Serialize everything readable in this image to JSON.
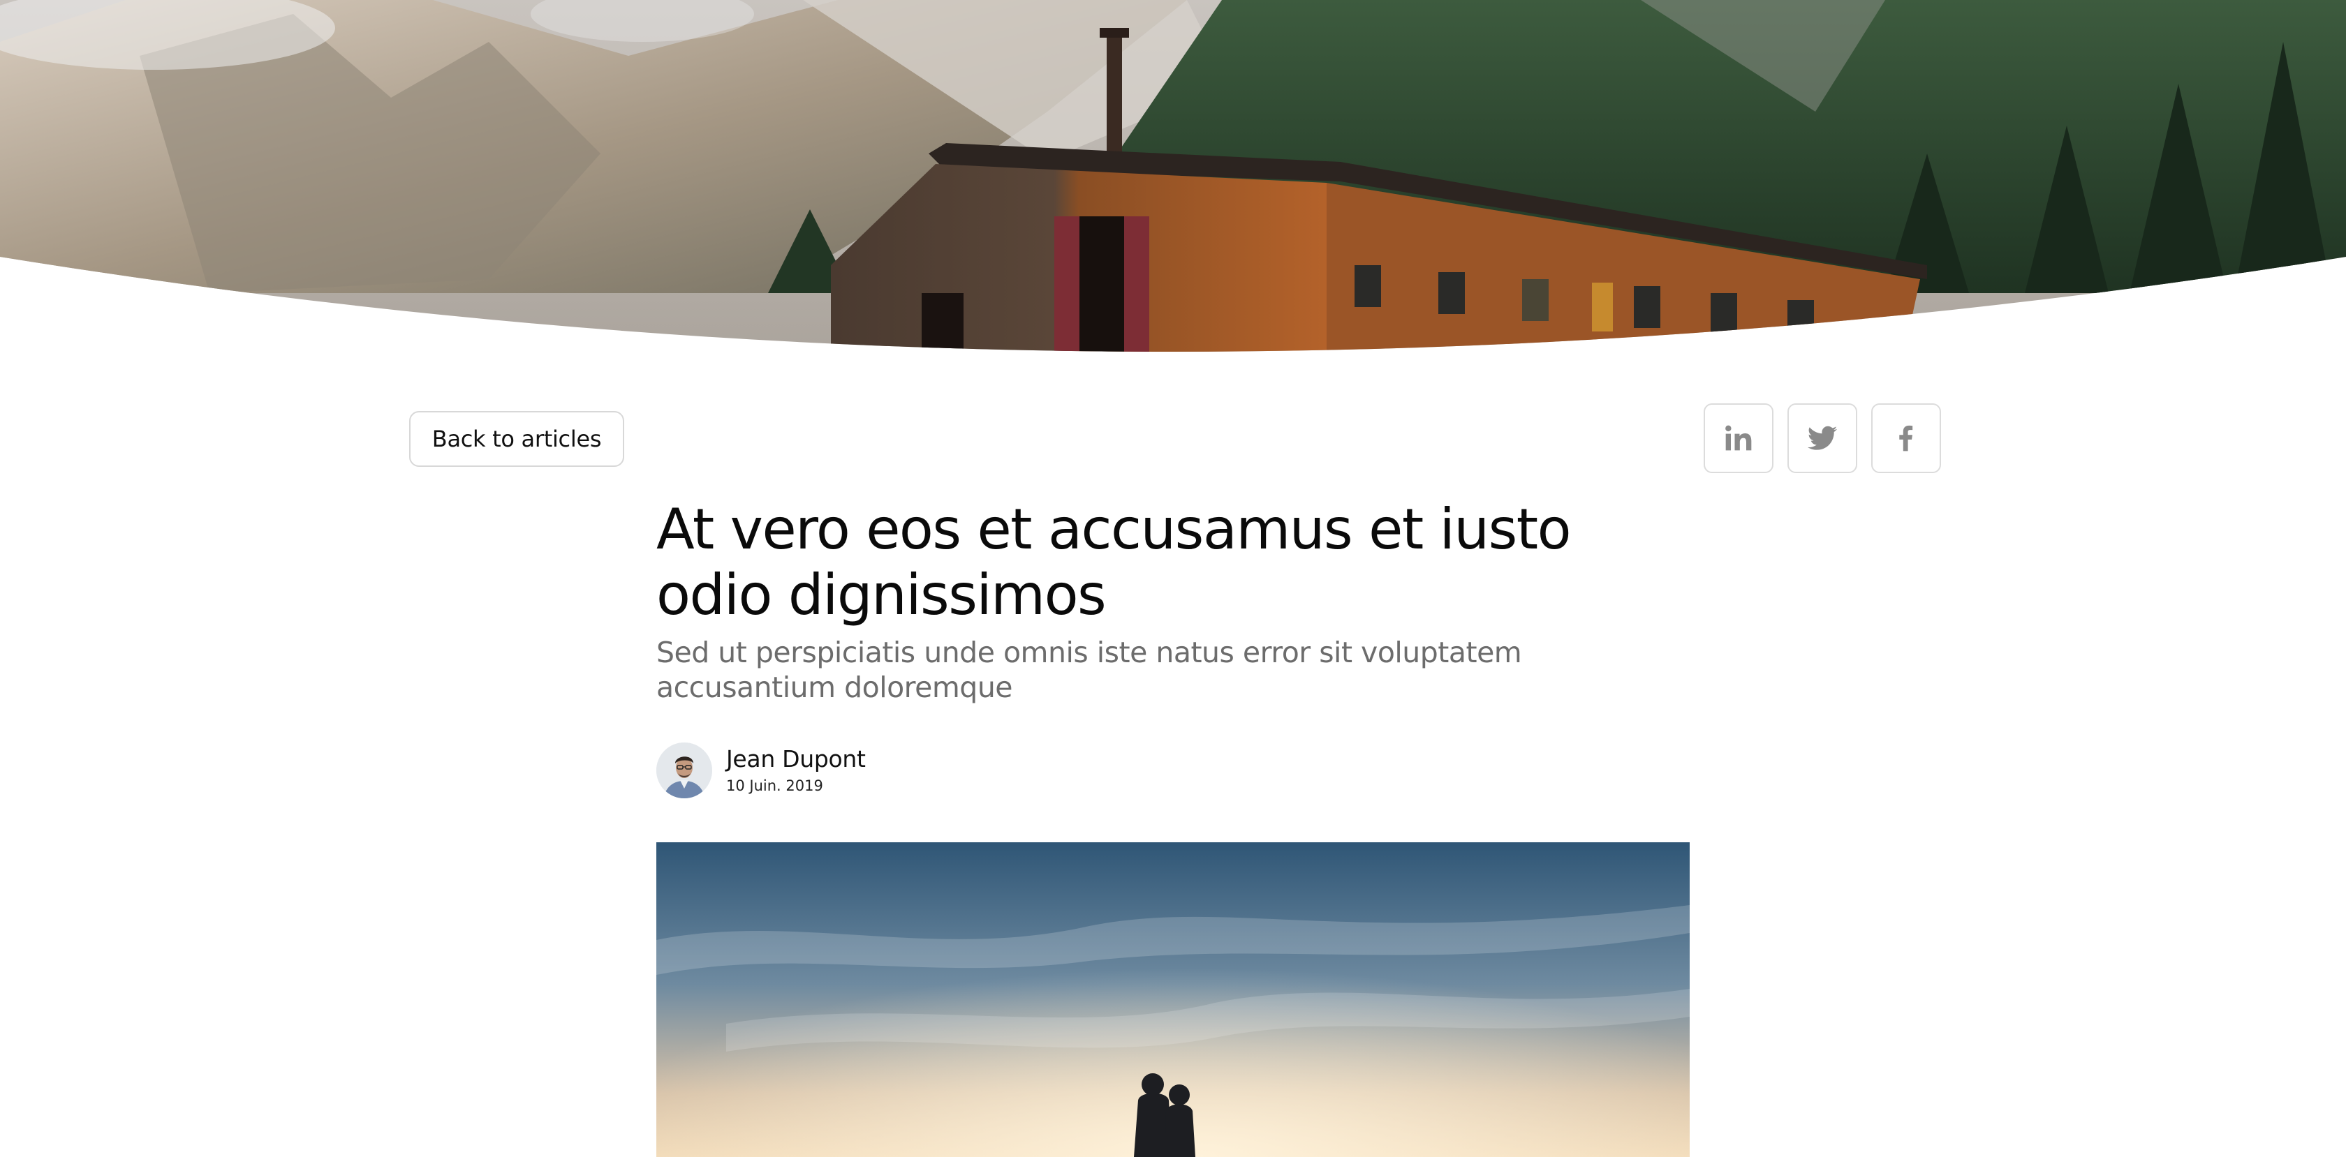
{
  "navigation": {
    "back_label": "Back to articles"
  },
  "share": [
    {
      "network": "linkedin",
      "icon": "linkedin-icon"
    },
    {
      "network": "twitter",
      "icon": "twitter-icon"
    },
    {
      "network": "facebook",
      "icon": "facebook-icon"
    }
  ],
  "article": {
    "title": "At vero eos et accusamus et iusto odio dignissimos",
    "subtitle": "Sed ut perspiciatis unde omnis iste natus error sit voluptatem accusantium doloremque",
    "author": {
      "name": "Jean Dupont",
      "date": "10 Juin. 2019"
    }
  },
  "colors": {
    "icon_gray": "#8a8a8a",
    "border_gray": "#d8d8d8",
    "subtitle_gray": "#6c6c6c"
  }
}
